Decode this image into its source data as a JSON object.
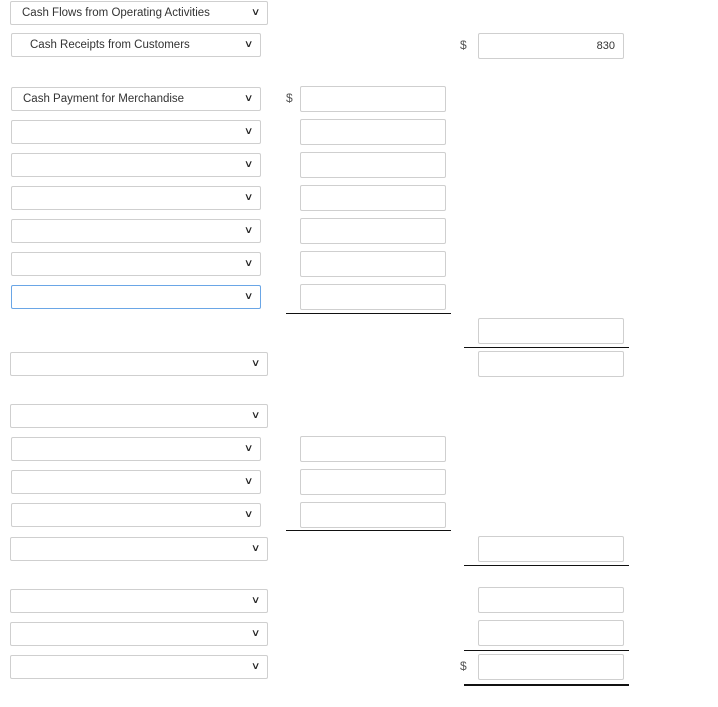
{
  "selects": {
    "r0": "Cash Flows from Operating Activities",
    "r1": "Cash Receipts from Customers",
    "r2": "Cash Payment for Merchandise"
  },
  "currency_symbol": "$",
  "inputs": {
    "receipts_amount": "830"
  },
  "icons": {
    "dropdown": "chevron-down-icon"
  }
}
